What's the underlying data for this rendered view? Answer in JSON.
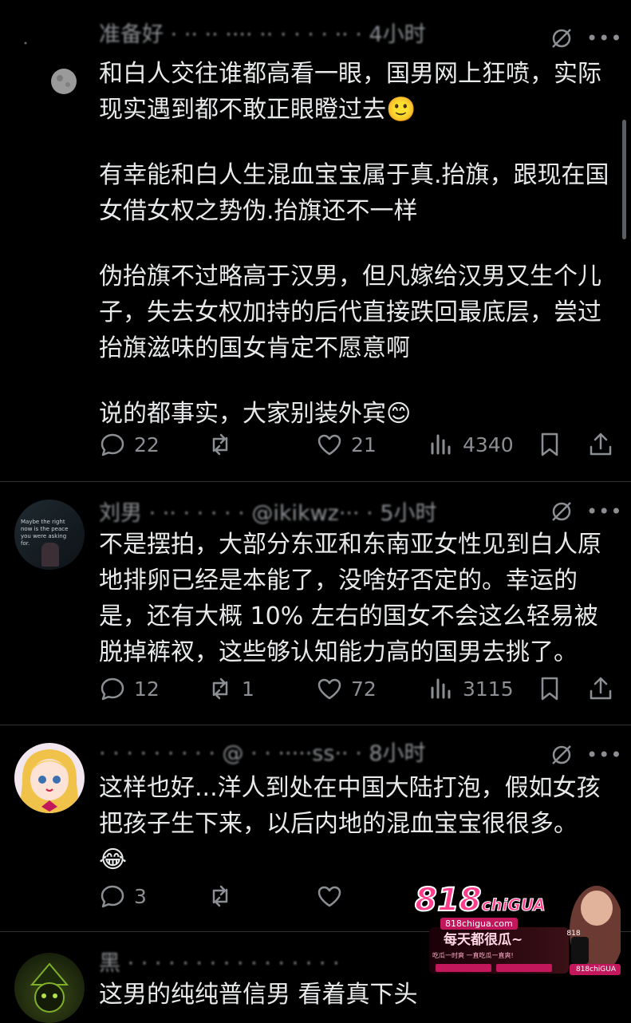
{
  "posts": [
    {
      "header": "准备好 · ·· ·· ···· ·· · · · · ·· · 4小时",
      "paragraphs": [
        "和白人交往谁都高看一眼，国男网上狂喷，实际现实遇到都不敢正眼瞪过去🙂",
        "有幸能和白人生混血宝宝属于真.抬旗，跟现在国女借女权之势伪.抬旗还不一样",
        "伪抬旗不过略高于汉男，但凡嫁给汉男又生个儿子，失去女权加持的后代直接跌回最底层，尝过抬旗滋味的国女肯定不愿意啊",
        "说的都事实，大家别装外宾😊"
      ],
      "stats": {
        "replies": "22",
        "reposts": "",
        "likes": "21",
        "views": "4340"
      }
    },
    {
      "header": "刘男 · ·· · · · · · @ikikwz··· · 5小时",
      "avatar_text": "Maybe the right now is the peace you were asking for.",
      "paragraphs": [
        "不是摆拍，大部分东亚和东南亚女性见到白人原地排卵已经是本能了，没啥好否定的。幸运的是，还有大概 10% 左右的国女不会这么轻易被脱掉裤衩，这些够认知能力高的国男去挑了。"
      ],
      "stats": {
        "replies": "12",
        "reposts": "1",
        "likes": "72",
        "views": "3115"
      }
    },
    {
      "header": "· · · · · · · · · @ · · ·····ss·· · 8小时",
      "paragraphs": [
        "这样也好...洋人到处在中国大陆打泡，假如女孩把孩子生下来，以后内地的混血宝宝很很多。",
        "😂"
      ],
      "stats": {
        "replies": "3",
        "reposts": "",
        "likes": "",
        "views": ""
      }
    },
    {
      "header": "黑 · · · · · · · · · · · · · · · ·",
      "paragraphs": [
        "这男的纯纯普信男 看着真下头"
      ]
    }
  ],
  "ad": {
    "brand": "818",
    "brand_suffix": "chiGUA",
    "url": "818chigua.com",
    "slogan": "每天都很瓜~",
    "tagline": "吃瓜一时爽 一直吃瓜一直爽!",
    "badge": "818",
    "corner_label": "818chiGUA",
    "colors": {
      "pink": "#ff3d8b",
      "magenta": "#c2185b",
      "bg": "#1a0008"
    }
  },
  "colors": {
    "background": "#000000",
    "text": "#e7e9ea",
    "muted": "#8b8f93",
    "divider": "#2f3336"
  }
}
